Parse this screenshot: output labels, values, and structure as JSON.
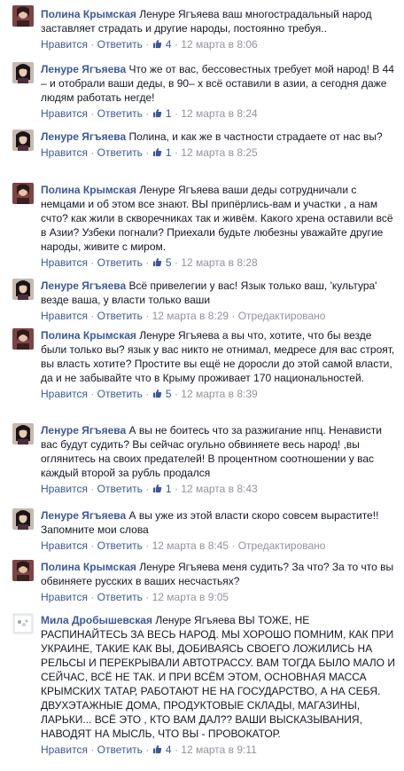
{
  "labels": {
    "like": "Нравится",
    "reply": "Ответить",
    "sep": " · ",
    "edited": "Отредактировано"
  },
  "colors": {
    "link": "#3b5998",
    "meta": "#90949c",
    "text": "#141823"
  },
  "comments": [
    {
      "author": "Полина Крымская",
      "text": "Ленуре Ягъяева ваш многострадальный народ заставляет страдать и другие народы, постоянно требуя..",
      "likes": "4",
      "date": "12 марта в 8:06",
      "avatar": "polina"
    },
    {
      "author": "Ленуре Ягъяева",
      "text": "Что же от вас, бессовестных требует мой народ! В 44 – и отобрали ваши деды, в 90– х всё оставили в азии, а сегодня даже людям работать негде!",
      "likes": "1",
      "date": "12 марта в 8:24",
      "avatar": "lenure"
    },
    {
      "author": "Ленуре Ягъяева",
      "text": "Полина, и как же в частности страдаете от нас вы?",
      "likes": "1",
      "date": "12 марта в 8:25",
      "avatar": "lenure"
    },
    {
      "author": "Полина Крымская",
      "text": "Ленуре Ягъяева ваши деды сотрудничали с немцами и об этом все знают. ВЫ припёрлись-вам и участки , а нам счто? как жили в скворечниках так и живём. Какого хрена оставили всё в Азии? Узбеки погнали? Приехали будьте любезны уважайте другие народы, живите с миром.",
      "likes": "5",
      "date": "12 марта в 8:28",
      "avatar": "polina"
    },
    {
      "author": "Ленуре Ягъяева",
      "text": "Всё привелегии у вас! Язык только ваш, 'культура' везде ваша, у власти только ваши",
      "likes": "",
      "date": "12 марта в 8:29",
      "edited": true,
      "avatar": "lenure"
    },
    {
      "author": "Полина Крымская",
      "text": "Ленуре Ягъяева а вы что, хотите, что бы везде были только вы? язык у вас никто не отнимал, медресе для вас строят, вы власть хотите? Простите вы ещё не доросли до этой самой власти, да и не забывайте что в Крыму проживает 170 национальностей.",
      "likes": "5",
      "date": "12 марта в 8:39",
      "avatar": "polina"
    },
    {
      "author": "Ленуре Ягъяева",
      "text": "А вы не боитесь что за разжигание нпц. Ненависти вас будут судить? Вы сейчас огульно обвиняете весь народ! ,вы оглянитесь на своих предателей! В процентном соотношении у вас каждый второй за рубль продался",
      "likes": "1",
      "date": "12 марта в 8:43",
      "avatar": "lenure"
    },
    {
      "author": "Ленуре Ягъяева",
      "text": "А вы уже из этой власти скоро совсем вырастите!! Запомните мои слова",
      "likes": "",
      "date": "12 марта в 8:45",
      "edited": true,
      "avatar": "lenure"
    },
    {
      "author": "Полина Крымская",
      "text": "Ленуре Ягъяева меня судить? За что? За то что вы обвиняете русских в ваших несчастьях?",
      "likes": "",
      "date": "12 марта в 9:05",
      "avatar": "polina"
    },
    {
      "author": "Мила Дробышевская",
      "text": "Ленуре Ягъяева ВЫ ТОЖЕ, НЕ РАСПИНАЙТЕСЬ ЗА ВЕСЬ НАРОД. МЫ ХОРОШО ПОМНИМ, КАК ПРИ УКРАИНЕ, ТАКИЕ КАК ВЫ, ДОБИВАЯСЬ СВОЕГО ЛОЖИЛИСЬ НА РЕЛЬСЫ И ПЕРЕКРЫВАЛИ АВТОТРАССУ. ВАМ ТОГДА БЫЛО МАЛО И СЕЙЧАС, ВСЁ НЕ ТАК. И ПРИ ВСЁМ ЭТОМ, ОСНОВНАЯ МАССА КРЫМСКИХ ТАТАР, РАБОТАЮТ НЕ НА ГОСУДАРСТВО, А НА СЕБЯ. ДВУХЭТАЖНЫЕ ДОМА, ПРОДУКТОВЫЕ СКЛАДЫ, МАГАЗИНЫ, ЛАРЬКИ... ВСЁ ЭТО , КТО ВАМ ДАЛ?? ВАШИ ВЫСКАЗЫВАНИЯ, НАВОДЯТ НА МЫСЛЬ, ЧТО ВЫ - ПРОВОКАТОР.",
      "likes": "4",
      "date": "12 марта в 9:11",
      "avatar": "mila"
    }
  ]
}
